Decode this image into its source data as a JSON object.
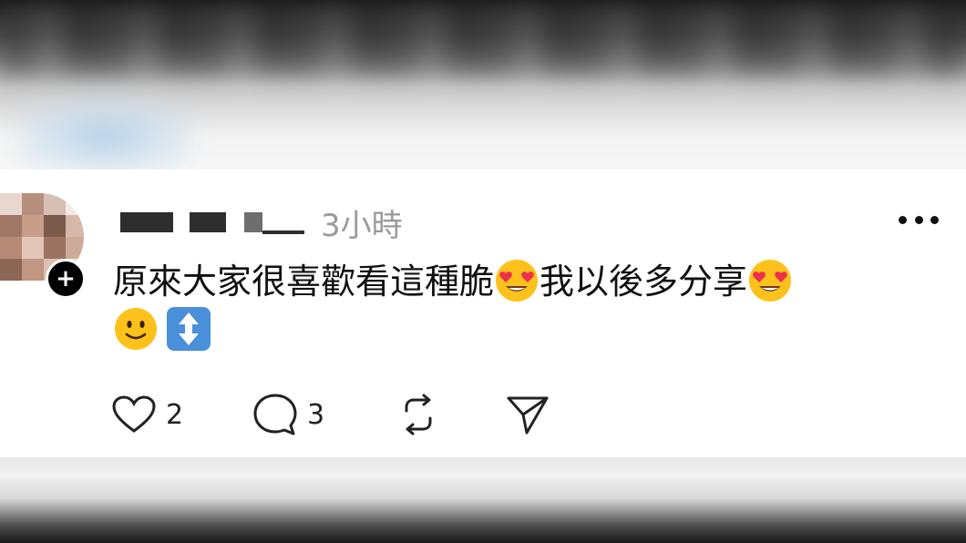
{
  "post": {
    "timestamp": "3小時",
    "text": "原來大家很喜歡看這種脆",
    "text_2": "我以後多分享",
    "emojis": [
      "heart-eyes-emoji",
      "heart-eyes-emoji",
      "slightly-smiling-emoji",
      "up-down-arrow-emoji"
    ]
  },
  "actions": {
    "like_count": "2",
    "comment_count": "3"
  },
  "colors": {
    "text": "#111111",
    "timestamp": "#9a9a9a",
    "emoji_yellow": "#fcc21b",
    "heart_red": "#ef2f4e",
    "arrow_blue": "#4a8fd9"
  }
}
